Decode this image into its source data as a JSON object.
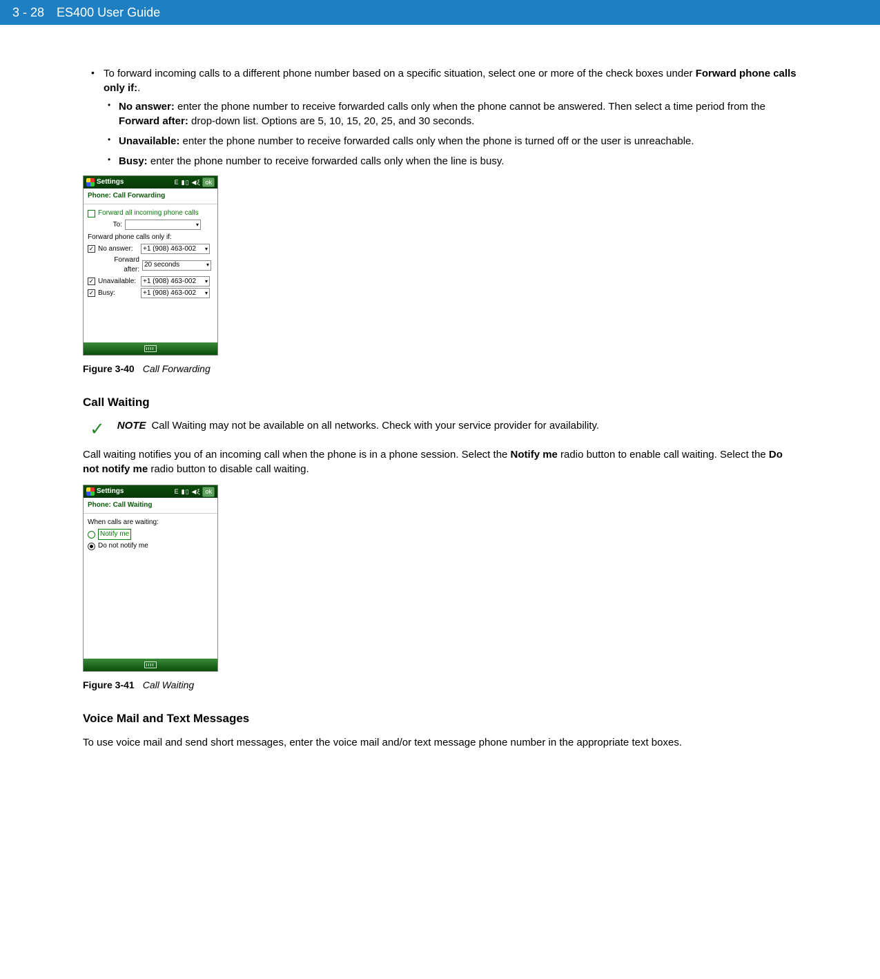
{
  "header": {
    "page_num": "3 - 28",
    "title": "ES400 User Guide"
  },
  "bullets": {
    "main": "To forward incoming calls to a different phone number based on a specific situation, select one or more of the check boxes under ",
    "main_bold": "Forward phone calls only if:",
    "main_end": ".",
    "no_answer_label": "No answer:",
    "no_answer_text": " enter the phone number to receive forwarded calls only when the phone cannot be answered. Then select a time period from the ",
    "no_answer_bold2": "Forward after:",
    "no_answer_text2": " drop-down list. Options are 5, 10, 15, 20, 25, and 30 seconds.",
    "unavailable_label": "Unavailable:",
    "unavailable_text": " enter the phone number to receive forwarded calls only when the phone is turned off or the user is unreachable.",
    "busy_label": "Busy:",
    "busy_text": " enter the phone number to receive forwarded calls only when the line is busy."
  },
  "screenshot1": {
    "titlebar": "Settings",
    "status_e": "E",
    "ok": "ok",
    "subtitle": "Phone: Call Forwarding",
    "forward_all": "Forward all incoming phone calls",
    "to_label": "To:",
    "only_if_label": "Forward phone calls only if:",
    "no_answer": "No answer:",
    "no_answer_val": "+1 (908) 463-002",
    "forward_after": "Forward after:",
    "forward_after_val": "20 seconds",
    "unavailable": "Unavailable:",
    "unavailable_val": "+1 (908) 463-002",
    "busy": "Busy:",
    "busy_val": "+1 (908) 463-002"
  },
  "fig1": {
    "num": "Figure 3-40",
    "title": "Call Forwarding"
  },
  "call_waiting_h": "Call Waiting",
  "note": {
    "label": "NOTE",
    "text": "Call Waiting may not be available on all networks. Check with your service provider for availability."
  },
  "cw_para_1": "Call waiting notifies you of an incoming call when the phone is in a phone session. Select the ",
  "cw_para_b1": "Notify me",
  "cw_para_2": " radio button to enable call waiting. Select the ",
  "cw_para_b2": "Do not notify me",
  "cw_para_3": " radio button to disable call waiting.",
  "screenshot2": {
    "titlebar": "Settings",
    "status_e": "E",
    "ok": "ok",
    "subtitle": "Phone: Call Waiting",
    "when_label": "When calls are waiting:",
    "notify": "Notify me",
    "donot": "Do not notify me"
  },
  "fig2": {
    "num": "Figure 3-41",
    "title": "Call Waiting"
  },
  "vm_h": "Voice Mail and Text Messages",
  "vm_para": "To use voice mail and send short messages, enter the voice mail and/or text message phone number in the appropriate text boxes."
}
